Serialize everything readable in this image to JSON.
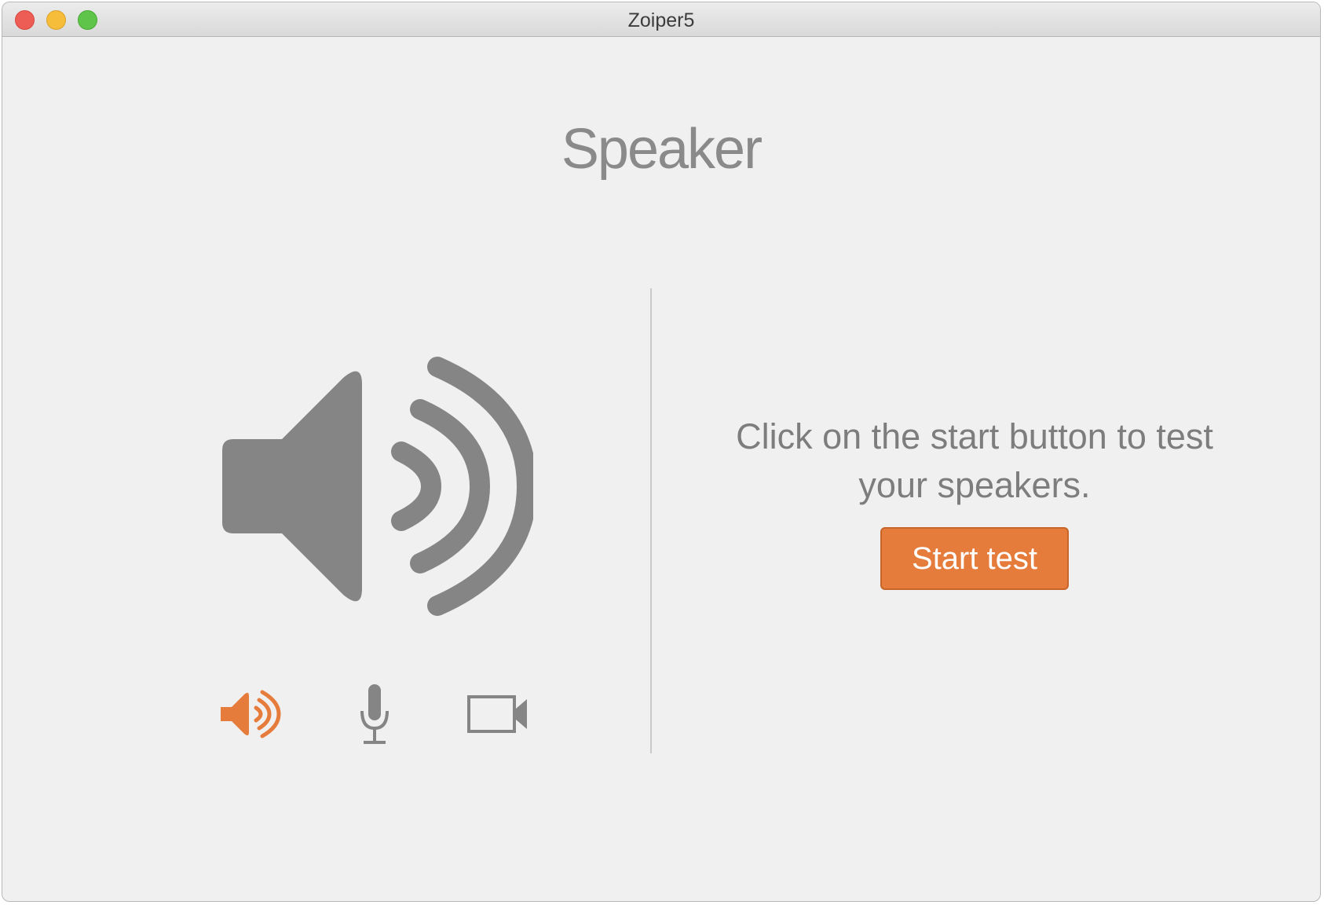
{
  "window": {
    "title": "Zoiper5",
    "controls": [
      "close",
      "minimize",
      "zoom"
    ]
  },
  "page": {
    "heading": "Speaker",
    "main_icon": "speaker-icon"
  },
  "device_tabs": [
    {
      "name": "speaker",
      "icon": "speaker-icon",
      "active": true
    },
    {
      "name": "microphone",
      "icon": "microphone-icon",
      "active": false
    },
    {
      "name": "camera",
      "icon": "video-camera-icon",
      "active": false
    }
  ],
  "test_panel": {
    "instructions": "Click on the start button to test your speakers.",
    "start_button_label": "Start test"
  },
  "colors": {
    "accent": "#e67c3b",
    "icon_gray": "#858585",
    "text_gray": "#7d7d7d",
    "background": "#f0f0f0"
  }
}
